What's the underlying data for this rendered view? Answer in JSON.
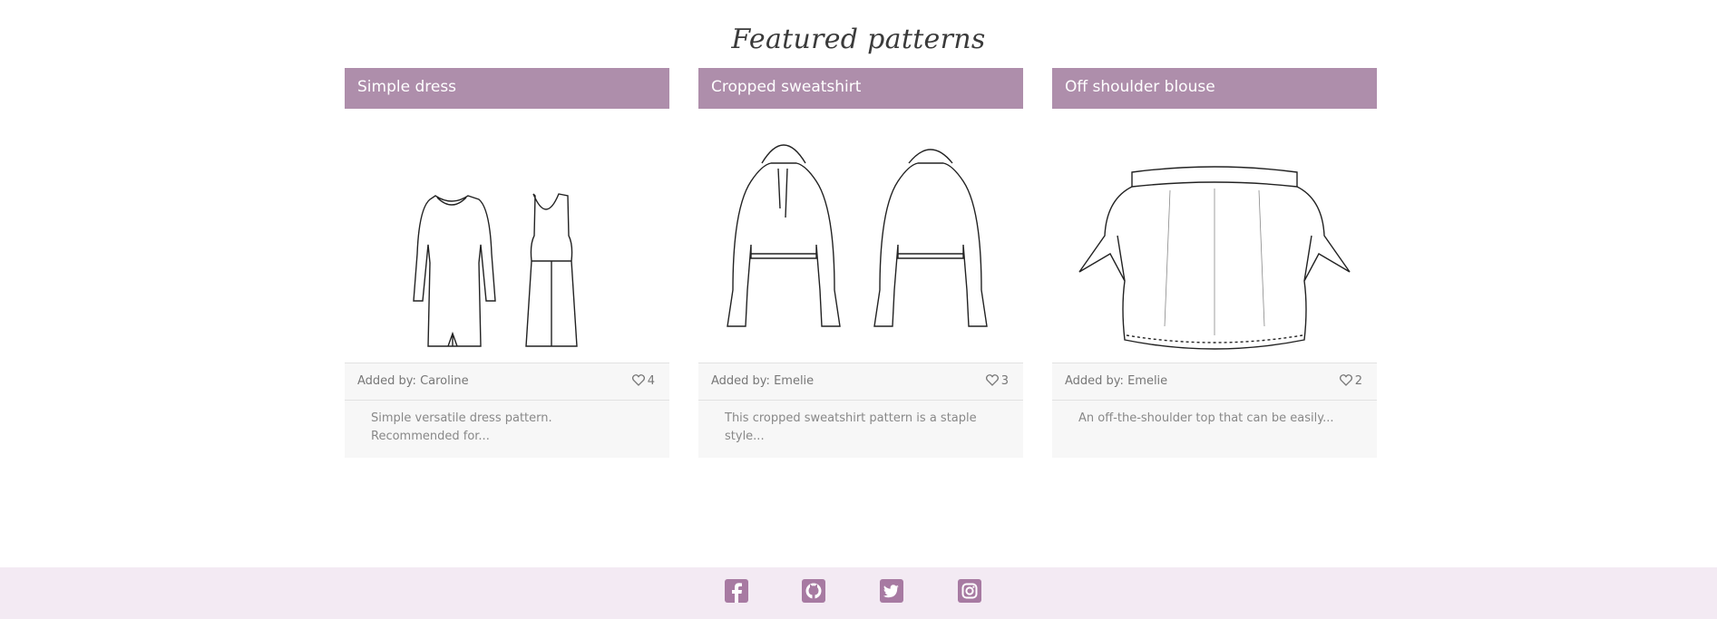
{
  "heading": "Featured patterns",
  "cards": [
    {
      "title": "Simple dress",
      "added_by": "Added by: Caroline",
      "likes": "4",
      "description": "Simple versatile dress pattern. Recommended for..."
    },
    {
      "title": "Cropped sweatshirt",
      "added_by": "Added by: Emelie",
      "likes": "3",
      "description": "This cropped sweatshirt pattern is a staple style..."
    },
    {
      "title": "Off shoulder blouse",
      "added_by": "Added by: Emelie",
      "likes": "2",
      "description": "An off-the-shoulder top that can be easily..."
    }
  ],
  "footer": {
    "icons": [
      "facebook-icon",
      "github-icon",
      "twitter-icon",
      "instagram-icon"
    ]
  },
  "colors": {
    "accent": "#ae8eab",
    "footer_bg": "#f3eaf3",
    "card_bg": "#f7f7f7"
  }
}
